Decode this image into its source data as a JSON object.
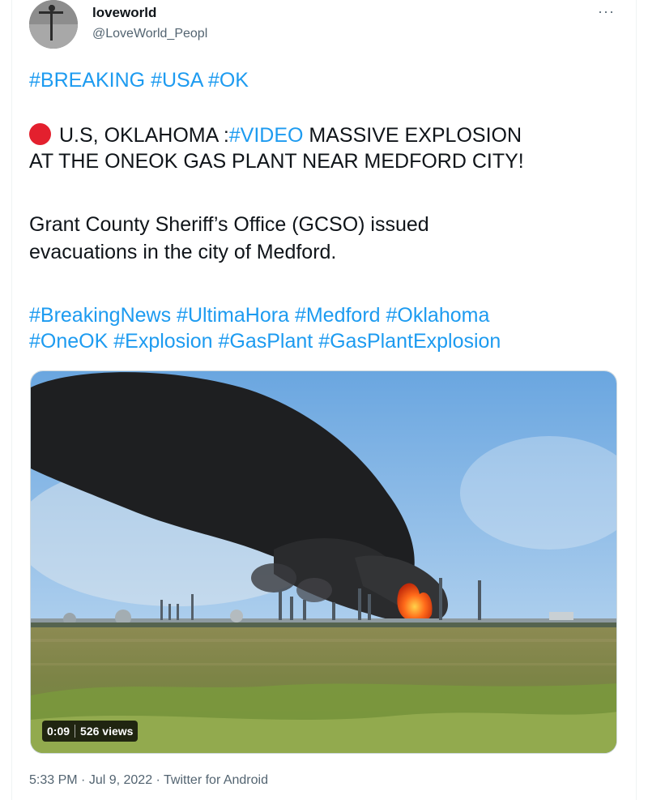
{
  "author": {
    "display_name": "loveworld",
    "handle": "@LoveWorld_Peopl",
    "more_label": "···"
  },
  "tweet": {
    "line1": [
      "#BREAKING",
      "#USA",
      "#OK"
    ],
    "line2_prefix": "U.S, OKLAHOMA :",
    "line2_hashtag": "#VIDEO",
    "line2_suffix": " MASSIVE EXPLOSION",
    "line3": "AT THE ONEOK GAS PLANT NEAR MEDFORD CITY!",
    "line4": "Grant County Sheriff’s Office (GCSO) issued",
    "line5": "evacuations in the city of Medford.",
    "line6": [
      "#BreakingNews",
      "#UltimaHora",
      "#Medford",
      "#Oklahoma"
    ],
    "line7": [
      "#OneOK",
      "#Explosion",
      "#GasPlant",
      "#GasPlantExplosion"
    ]
  },
  "video": {
    "duration": "0:09",
    "views": "526 views"
  },
  "meta": {
    "time": "5:33 PM",
    "date": "Jul 9, 2022",
    "source": "Twitter for Android",
    "dot": " · "
  },
  "colors": {
    "hashtag": "#1d9bf0",
    "text": "#0f1419",
    "secondary": "#536471",
    "red_dot": "#e3202e"
  }
}
